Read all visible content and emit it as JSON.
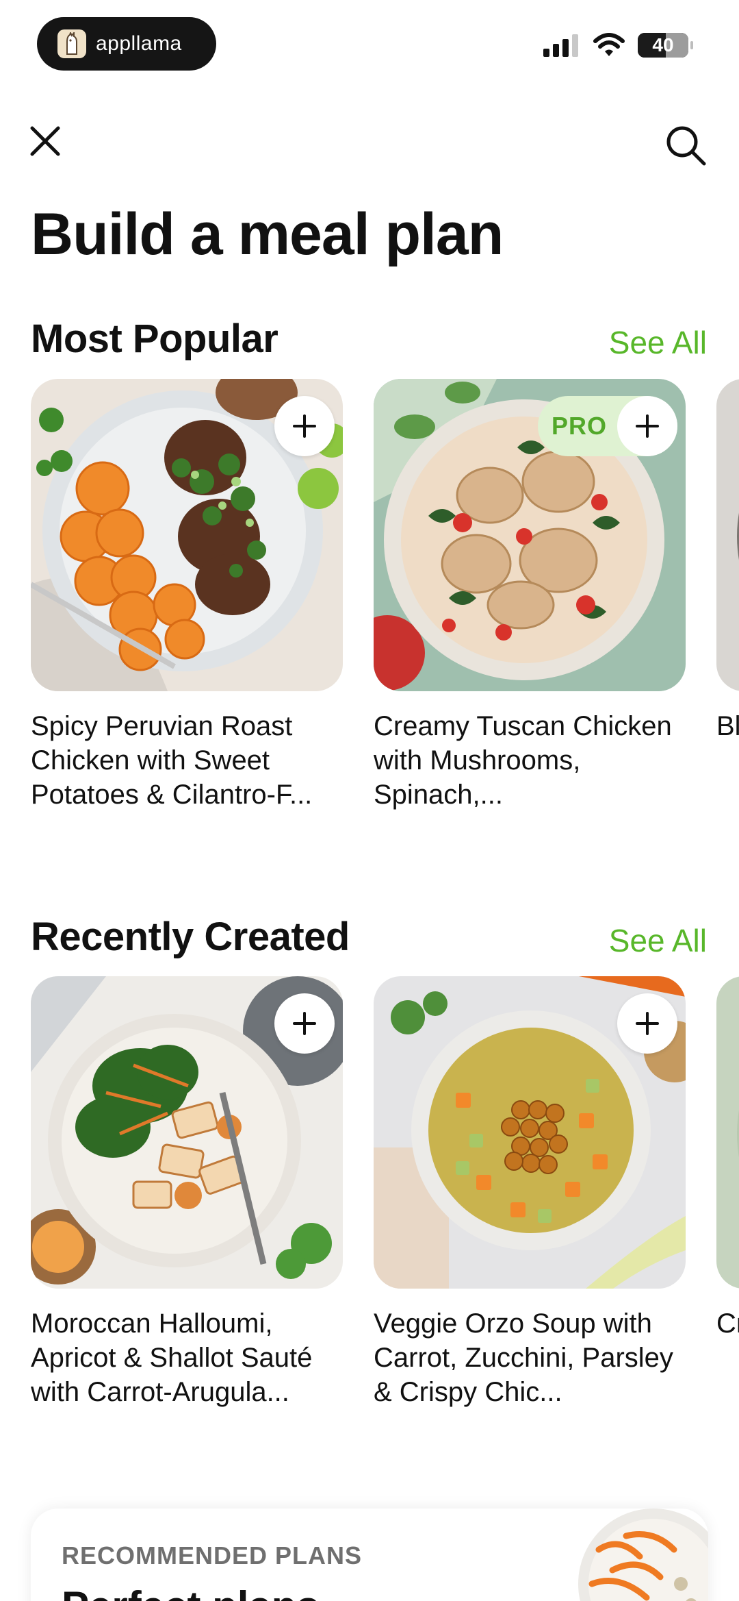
{
  "status_bar": {
    "brand": "appllama",
    "battery": "40"
  },
  "header": {
    "title": "Build a meal plan"
  },
  "sections": [
    {
      "title": "Most Popular",
      "see_all": "See All",
      "cards": [
        {
          "title": "Spicy Peruvian Roast Chicken with Sweet Potatoes & Cilantro-F...",
          "pro": false
        },
        {
          "title": "Creamy Tuscan Chicken with Mushrooms, Spinach,...",
          "pro": true,
          "badge": "PRO"
        },
        {
          "title": "Bl Q To",
          "pro": false
        }
      ]
    },
    {
      "title": "Recently Created",
      "see_all": "See All",
      "cards": [
        {
          "title": "Moroccan Halloumi, Apricot & Shallot Sauté with Carrot-Arugula...",
          "pro": false
        },
        {
          "title": "Veggie Orzo Soup with Carrot, Zucchini, Parsley & Crispy Chic...",
          "pro": false
        },
        {
          "title": "Cr M Sl",
          "pro": false
        }
      ]
    }
  ],
  "recommended": {
    "label": "RECOMMENDED PLANS",
    "title": "Perfect plans"
  },
  "colors": {
    "accent": "#58b72a",
    "pro_bg": "#dff2d2",
    "text": "#111111"
  },
  "icons": {
    "close": "close-icon",
    "search": "search-icon",
    "add": "plus-icon"
  }
}
